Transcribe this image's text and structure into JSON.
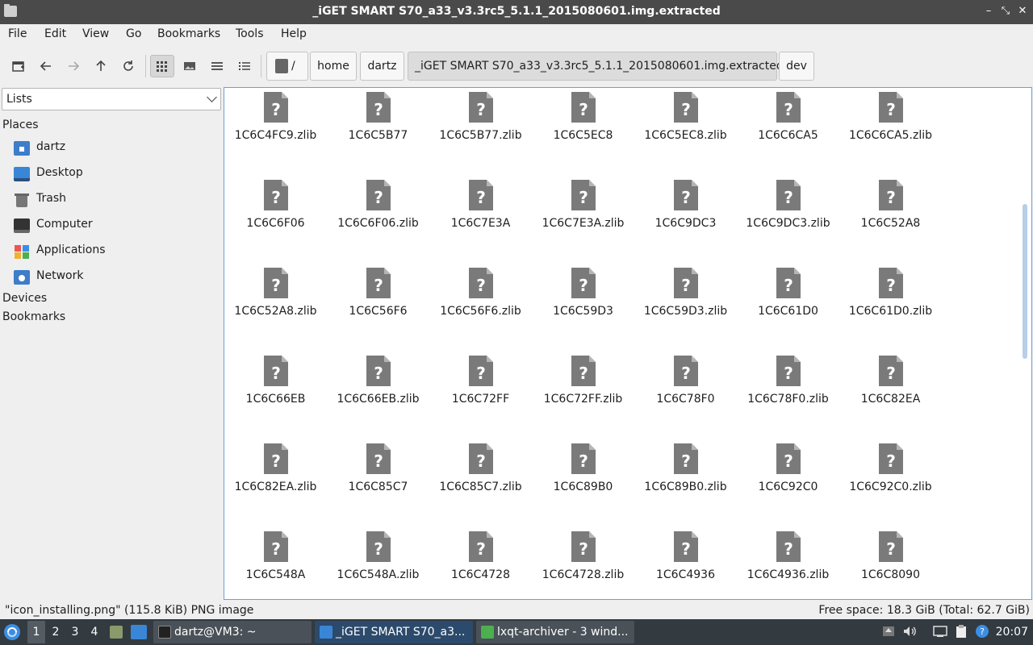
{
  "window": {
    "title": "_iGET SMART S70_a33_v3.3rc5_5.1.1_2015080601.img.extracted",
    "buttons": {
      "minimize": "–",
      "restore": "⤡",
      "close": "✕"
    }
  },
  "menu": [
    "File",
    "Edit",
    "View",
    "Go",
    "Bookmarks",
    "Tools",
    "Help"
  ],
  "path": {
    "root": "/",
    "crumbs": [
      "home",
      "dartz",
      "_iGET SMART S70_a33_v3.3rc5_5.1.1_2015080601.img.extracted",
      "dev"
    ]
  },
  "sidebar": {
    "mode": "Lists",
    "places_label": "Places",
    "places": [
      {
        "label": "dartz",
        "icon": "home-folder-icon"
      },
      {
        "label": "Desktop",
        "icon": "desktop-icon"
      },
      {
        "label": "Trash",
        "icon": "trash-icon"
      },
      {
        "label": "Computer",
        "icon": "computer-icon"
      },
      {
        "label": "Applications",
        "icon": "applications-icon"
      },
      {
        "label": "Network",
        "icon": "network-icon"
      }
    ],
    "devices_label": "Devices",
    "bookmarks_label": "Bookmarks"
  },
  "files": [
    "1C6C4FC9.zlib",
    "1C6C5B77",
    "1C6C5B77.zlib",
    "1C6C5EC8",
    "1C6C5EC8.zlib",
    "1C6C6CA5",
    "1C6C6CA5.zlib",
    "1C6C6F06",
    "1C6C6F06.zlib",
    "1C6C7E3A",
    "1C6C7E3A.zlib",
    "1C6C9DC3",
    "1C6C9DC3.zlib",
    "1C6C52A8",
    "1C6C52A8.zlib",
    "1C6C56F6",
    "1C6C56F6.zlib",
    "1C6C59D3",
    "1C6C59D3.zlib",
    "1C6C61D0",
    "1C6C61D0.zlib",
    "1C6C66EB",
    "1C6C66EB.zlib",
    "1C6C72FF",
    "1C6C72FF.zlib",
    "1C6C78F0",
    "1C6C78F0.zlib",
    "1C6C82EA",
    "1C6C82EA.zlib",
    "1C6C85C7",
    "1C6C85C7.zlib",
    "1C6C89B0",
    "1C6C89B0.zlib",
    "1C6C92C0",
    "1C6C92C0.zlib",
    "1C6C548A",
    "1C6C548A.zlib",
    "1C6C4728",
    "1C6C4728.zlib",
    "1C6C4936",
    "1C6C4936.zlib",
    "1C6C8090"
  ],
  "file_icon": "unknown-file-icon",
  "status": {
    "selection": "\"icon_installing.png\" (115.8 KiB) PNG image",
    "free_space": "Free space: 18.3 GiB (Total: 62.7 GiB)"
  },
  "taskbar": {
    "desktops": [
      "1",
      "2",
      "3",
      "4"
    ],
    "windows": [
      {
        "label": "dartz@VM3: ~",
        "icon": "terminal-icon"
      },
      {
        "label": "_iGET SMART S70_a3...",
        "icon": "folder-icon"
      },
      {
        "label": "lxqt-archiver - 3 wind...",
        "icon": "archiver-icon"
      }
    ],
    "clock": "20:07"
  },
  "colors": {
    "titlebar": "#4a4a4a",
    "selection_border": "#6ba0d8",
    "taskbar": "#333a40",
    "file_icon": "#7a7a7a"
  }
}
